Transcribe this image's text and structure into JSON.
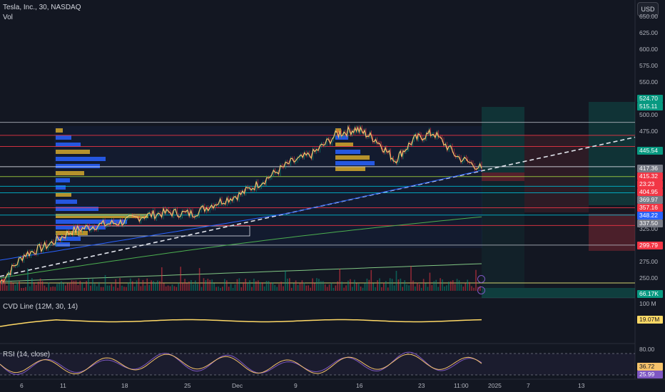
{
  "header": {
    "symbol_line": "Tesla, Inc., 30, NASDAQ",
    "vol_label": "Vol",
    "currency_button": "USD"
  },
  "price_axis": {
    "ticks": [
      "650.00",
      "625.00",
      "600.00",
      "575.00",
      "550.00",
      "500.00",
      "475.00",
      "325.00",
      "275.00",
      "250.00"
    ],
    "tick_values": [
      650,
      625,
      600,
      575,
      550,
      500,
      475,
      325,
      275,
      250
    ]
  },
  "price_labels": [
    {
      "text": "524.70",
      "value": 524.7,
      "color": "#089981"
    },
    {
      "text": "515.11",
      "value": 515.11,
      "color": "#089981"
    },
    {
      "text": "445.54",
      "value": 445.54,
      "color": "#089981"
    },
    {
      "text": "417.36",
      "value": 417.36,
      "color": "#787b86"
    },
    {
      "text": "415.32",
      "value": 415.32,
      "color": "#f23645"
    },
    {
      "text": "23:23",
      "value": 409.6,
      "color": "#f23645"
    },
    {
      "text": "404.95",
      "value": 404.95,
      "color": "#f23645"
    },
    {
      "text": "369.97",
      "value": 369.97,
      "color": "#787b86"
    },
    {
      "text": "357.16",
      "value": 357.16,
      "color": "#f23645"
    },
    {
      "text": "348.22",
      "value": 348.22,
      "color": "#2962ff"
    },
    {
      "text": "337.50",
      "value": 337.5,
      "color": "#787b86"
    },
    {
      "text": "299.79",
      "value": 299.79,
      "color": "#f23645"
    }
  ],
  "volume_panel": {
    "axis_label": "100 M",
    "value_label": "66.17K"
  },
  "cvd_panel": {
    "title": "CVD Line (12M, 30, 14)",
    "value_label": "19.07M",
    "line_color": "#ffd966"
  },
  "rsi_panel": {
    "title": "RSI (14, close)",
    "axis_label": "80.00",
    "value_label": "36.72",
    "value_label_2": "25.99",
    "line_color": "#f5c26b"
  },
  "time_axis": {
    "labels": [
      "6",
      "11",
      "18",
      "25",
      "Dec",
      "9",
      "16",
      "23",
      "11:00",
      "2025",
      "7",
      "13"
    ]
  },
  "colors": {
    "background": "#131722",
    "up": "#089981",
    "down": "#f23645",
    "accent_yellow": "#f5c26b",
    "blue": "#2962ff"
  },
  "chart_data": {
    "type": "line",
    "y_range": [
      230,
      660
    ],
    "horizontal_levels": [
      {
        "value": 488,
        "color": "#b2b5be"
      },
      {
        "value": 468,
        "color": "#f23645"
      },
      {
        "value": 451,
        "color": "#f23645"
      },
      {
        "value": 420,
        "color": "#e0e3eb"
      },
      {
        "value": 404.95,
        "color": "#a5d63f"
      },
      {
        "value": 390,
        "color": "#00bcd4"
      },
      {
        "value": 380,
        "color": "#00bcd4"
      },
      {
        "value": 357.16,
        "color": "#f23645"
      },
      {
        "value": 346,
        "color": "#00bcd4"
      },
      {
        "value": 330,
        "color": "#f23645"
      },
      {
        "value": 300,
        "color": "#b2b5be"
      },
      {
        "value": 242,
        "color": "#f5f57a"
      }
    ],
    "trendline": {
      "from": [
        0,
        300
      ],
      "to": [
        1,
        445.54
      ],
      "color": "#e0e3eb",
      "dashed": true
    },
    "price_series_keypoints": [
      [
        0,
        243
      ],
      [
        0.05,
        285
      ],
      [
        0.1,
        300
      ],
      [
        0.15,
        322
      ],
      [
        0.2,
        330
      ],
      [
        0.25,
        335
      ],
      [
        0.3,
        345
      ],
      [
        0.35,
        350
      ],
      [
        0.4,
        348
      ],
      [
        0.45,
        365
      ],
      [
        0.5,
        378
      ],
      [
        0.55,
        400
      ],
      [
        0.6,
        425
      ],
      [
        0.65,
        440
      ],
      [
        0.7,
        470
      ],
      [
        0.74,
        478
      ],
      [
        0.78,
        462
      ],
      [
        0.82,
        430
      ],
      [
        0.86,
        462
      ],
      [
        0.9,
        472
      ],
      [
        0.95,
        435
      ],
      [
        1,
        417.36
      ]
    ]
  }
}
